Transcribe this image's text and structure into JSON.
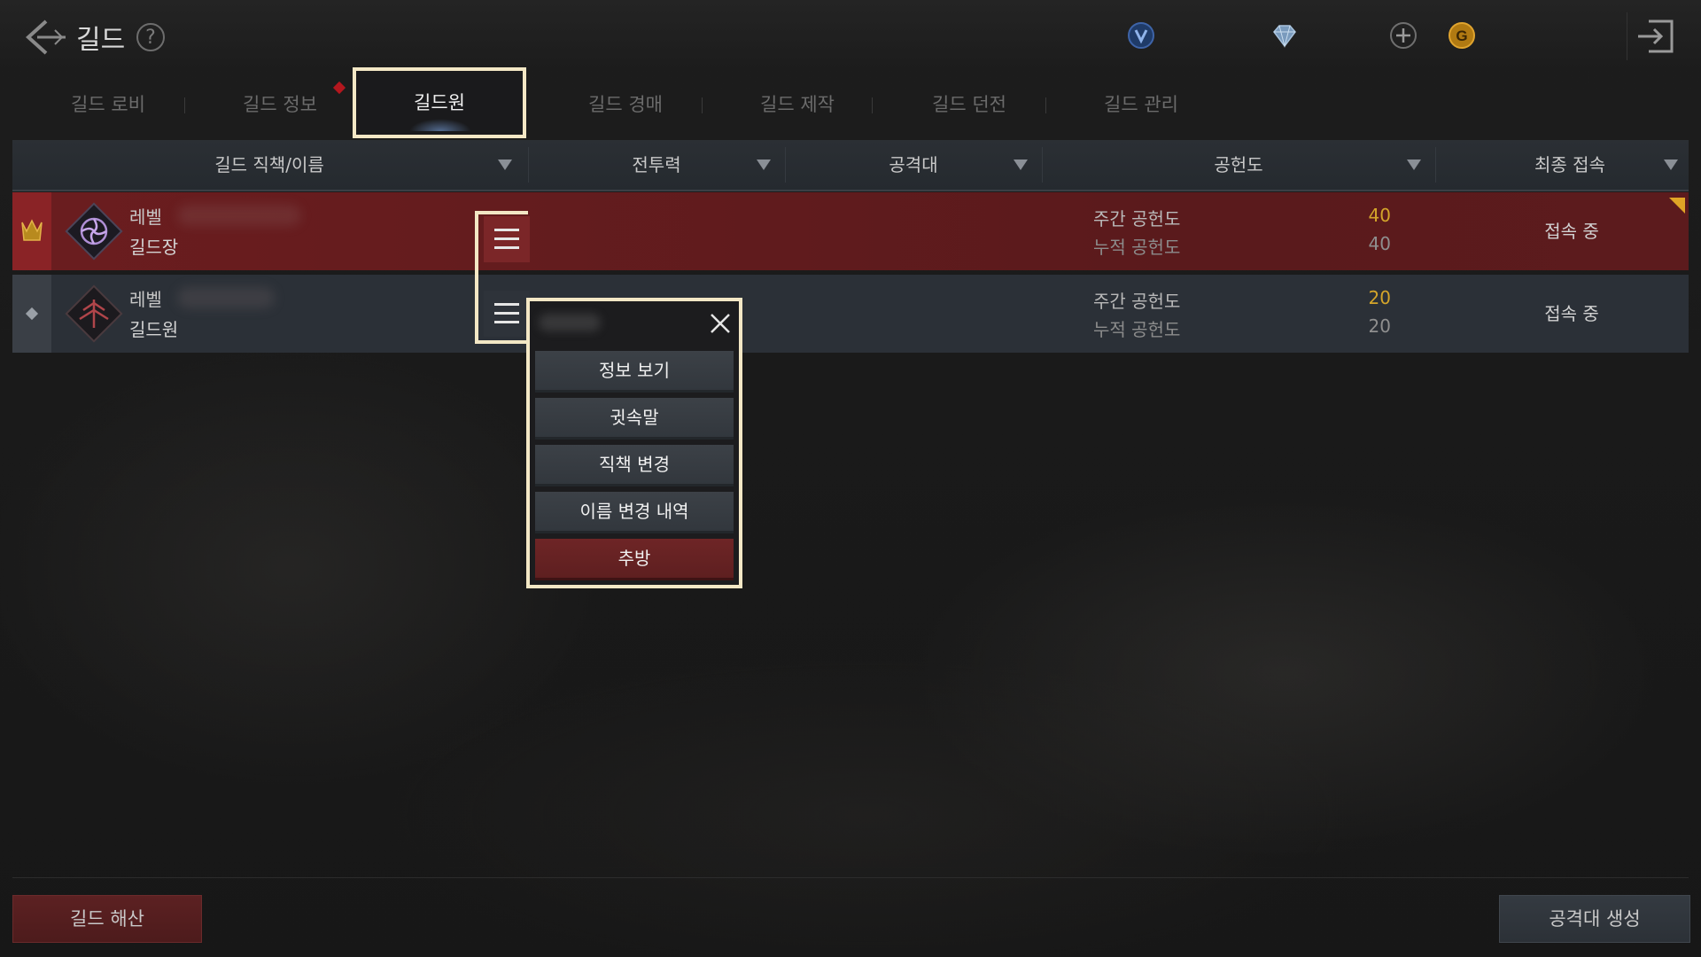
{
  "header": {
    "title": "길드",
    "help_icon": "?",
    "currencies": [
      "blue-crystal-icon",
      "diamond-icon",
      "plus-icon",
      "gold-coin-icon"
    ]
  },
  "tabs": [
    {
      "label": "길드 로비"
    },
    {
      "label": "길드 정보"
    },
    {
      "label": "길드원"
    },
    {
      "label": "길드 경매"
    },
    {
      "label": "길드 제작"
    },
    {
      "label": "길드 던전"
    },
    {
      "label": "길드 관리"
    }
  ],
  "table": {
    "columns": [
      "길드 직책/이름",
      "전투력",
      "공격대",
      "공헌도",
      "최종 접속"
    ],
    "rows": [
      {
        "level_label": "레벨",
        "rank": "길드장",
        "weekly_label": "주간 공헌도",
        "total_label": "누적 공헌도",
        "weekly": "40",
        "total": "40",
        "status": "접속 중"
      },
      {
        "level_label": "레벨",
        "rank": "길드원",
        "weekly_label": "주간 공헌도",
        "total_label": "누적 공헌도",
        "weekly": "20",
        "total": "20",
        "status": "접속 중"
      }
    ]
  },
  "context_menu": {
    "items": [
      "정보 보기",
      "귓속말",
      "직책 변경",
      "이름 변경 내역",
      "추방"
    ]
  },
  "footer": {
    "dissolve_label": "길드 해산",
    "create_raid_label": "공격대 생성"
  },
  "colors": {
    "accent_highlight": "#f3e7c5",
    "master_row": "#6b1d1f",
    "member_row": "#2b3037",
    "contribution_value": "#d4a52a"
  }
}
